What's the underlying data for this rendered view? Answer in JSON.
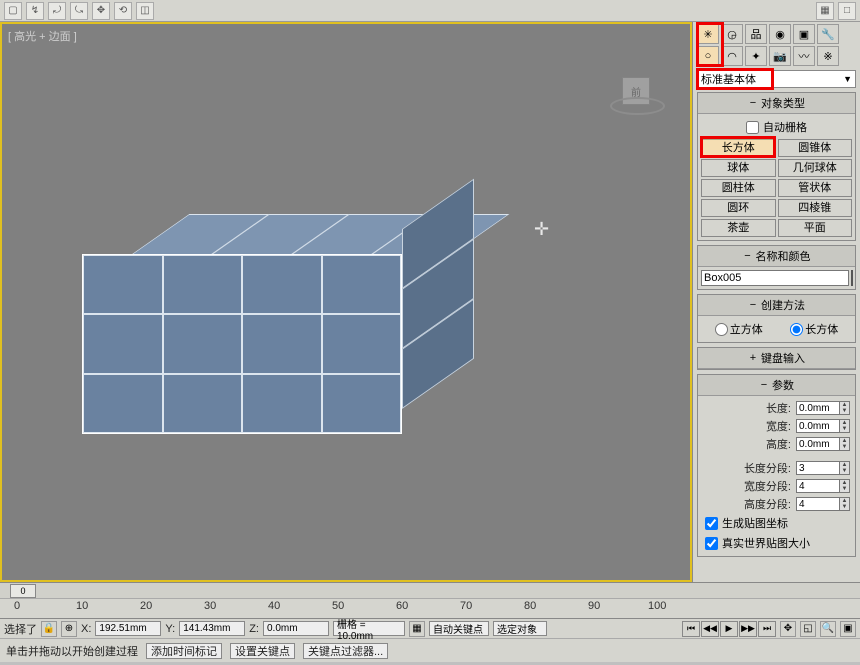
{
  "viewport": {
    "label": "[ 高光 + 边面 ]",
    "viewcube_face": "前"
  },
  "panel": {
    "dropdown_label": "标准基本体",
    "object_type_title": "对象类型",
    "auto_grid_label": "自动栅格",
    "types": {
      "box": "长方体",
      "cone": "圆锥体",
      "sphere": "球体",
      "geosphere": "几何球体",
      "cylinder": "圆柱体",
      "tube": "管状体",
      "torus": "圆环",
      "pyramid": "四棱锥",
      "teapot": "茶壶",
      "plane": "平面"
    },
    "name_title": "名称和颜色",
    "name_value": "Box005",
    "creation_method_title": "创建方法",
    "creation_cube": "立方体",
    "creation_box": "长方体",
    "kbd_entry_title": "键盘输入",
    "params_title": "参数",
    "length_label": "长度:",
    "length_value": "0.0mm",
    "width_label": "宽度:",
    "width_value": "0.0mm",
    "height_label": "高度:",
    "height_value": "0.0mm",
    "lsegs_label": "长度分段:",
    "lsegs_value": "3",
    "wsegs_label": "宽度分段:",
    "wsegs_value": "4",
    "hsegs_label": "高度分段:",
    "hsegs_value": "4",
    "gen_uv_label": "生成贴图坐标",
    "real_world_label": "真实世界贴图大小"
  },
  "timeline": {
    "handle": "0",
    "ticks": [
      "0",
      "10",
      "20",
      "30",
      "40",
      "50",
      "60",
      "70",
      "80",
      "90",
      "100"
    ]
  },
  "status": {
    "selected_label": "选择了",
    "x_label": "X:",
    "x_value": "192.51mm",
    "y_label": "Y:",
    "y_value": "141.43mm",
    "z_label": "Z:",
    "z_value": "0.0mm",
    "grid_label": "栅格 = 10.0mm",
    "autokey_label": "自动关键点",
    "selected_obj_label": "选定对象",
    "hint1": "单击并拖动以开始创建过程",
    "hint2": "添加时间标记",
    "setkey_label": "设置关键点",
    "keyfilter_label": "关键点过滤器..."
  }
}
